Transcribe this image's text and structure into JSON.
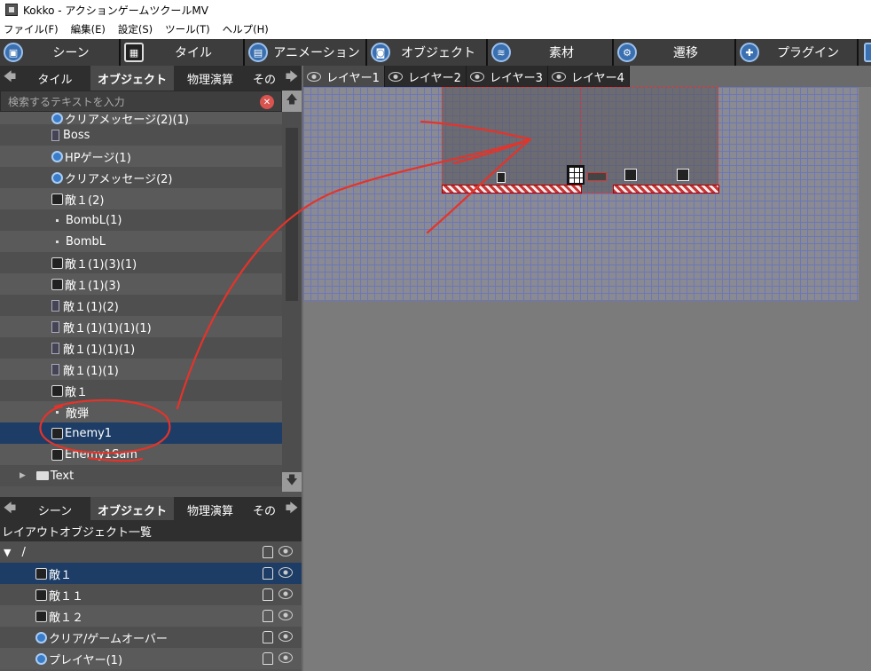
{
  "window": {
    "title": "Kokko - アクションゲームツクールMV"
  },
  "menu": [
    "ファイル(F)",
    "編集(E)",
    "設定(S)",
    "ツール(T)",
    "ヘルプ(H)"
  ],
  "toolbar": [
    {
      "label": "シーン",
      "icon": "scene-icon"
    },
    {
      "label": "タイル",
      "icon": "tile-icon"
    },
    {
      "label": "アニメーション",
      "icon": "animation-icon"
    },
    {
      "label": "オブジェクト",
      "icon": "object-icon"
    },
    {
      "label": "素材",
      "icon": "material-icon"
    },
    {
      "label": "遷移",
      "icon": "transition-icon"
    },
    {
      "label": "プラグイン",
      "icon": "plugin-icon"
    }
  ],
  "top_tabs": [
    "タイル",
    "オブジェクト",
    "物理演算",
    "その"
  ],
  "search": {
    "placeholder": "検索するテキストを入力"
  },
  "object_tree": [
    {
      "label": "クリアメッセージ(2)(1)",
      "icon": "circle"
    },
    {
      "label": "Boss",
      "icon": "small"
    },
    {
      "label": "HPゲージ(1)",
      "icon": "circle"
    },
    {
      "label": "クリアメッセージ(2)",
      "icon": "circle"
    },
    {
      "label": "敵１(2)",
      "icon": "chr"
    },
    {
      "label": "BombL(1)",
      "icon": "dot"
    },
    {
      "label": "BombL",
      "icon": "dot"
    },
    {
      "label": "敵１(1)(3)(1)",
      "icon": "chr"
    },
    {
      "label": "敵１(1)(3)",
      "icon": "chr"
    },
    {
      "label": "敵１(1)(2)",
      "icon": "small"
    },
    {
      "label": "敵１(1)(1)(1)(1)",
      "icon": "small"
    },
    {
      "label": "敵１(1)(1)(1)",
      "icon": "small"
    },
    {
      "label": "敵１(1)(1)",
      "icon": "small"
    },
    {
      "label": "敵１",
      "icon": "chr"
    },
    {
      "label": "敵弾",
      "icon": "dot"
    },
    {
      "label": "Enemy1",
      "icon": "chr",
      "selected": true
    },
    {
      "label": "Enemy1Sam",
      "icon": "chr"
    },
    {
      "label": "Text",
      "icon": "folder"
    }
  ],
  "bottom_tabs": [
    "シーン",
    "オブジェクト",
    "物理演算",
    "その"
  ],
  "layout_panel": {
    "header": "レイアウトオブジェクト一覧",
    "root": "/",
    "items": [
      {
        "label": "敵１",
        "icon": "chr",
        "selected": true
      },
      {
        "label": "敵１１",
        "icon": "chr"
      },
      {
        "label": "敵１２",
        "icon": "chr"
      },
      {
        "label": "クリア/ゲームオーバー",
        "icon": "circle"
      },
      {
        "label": "プレイヤー(1)",
        "icon": "circle"
      }
    ]
  },
  "layers": [
    {
      "label": "レイヤー1",
      "active": true
    },
    {
      "label": "レイヤー2"
    },
    {
      "label": "レイヤー3"
    },
    {
      "label": "レイヤー4"
    }
  ],
  "colors": {
    "accent": "#1d3d66",
    "annotation": "#e5332a"
  }
}
